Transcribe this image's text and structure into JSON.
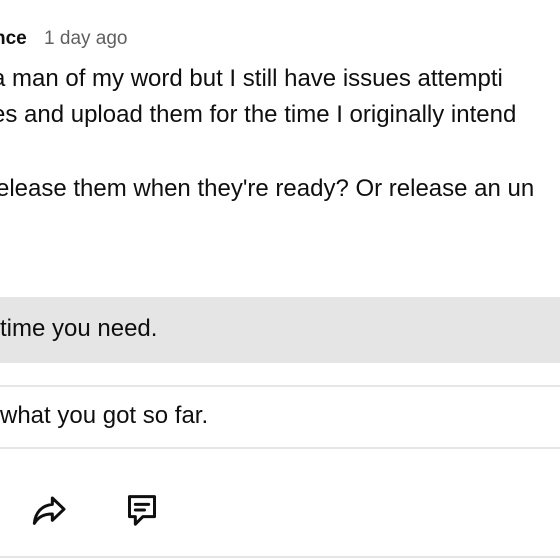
{
  "post": {
    "author": "nce",
    "timestamp": "1 day ago",
    "body_lines": [
      "a man of my word but I still have issues attempti",
      "es and upload them for the time I originally intend",
      "release them when they're ready? Or release an un"
    ]
  },
  "poll": {
    "options": [
      {
        "label": "time you need.",
        "state": "selected"
      },
      {
        "label": "what you got so far.",
        "state": "unselected"
      }
    ]
  },
  "actions": {
    "share_icon": "share-icon",
    "comment_icon": "comment-icon"
  },
  "colors": {
    "text": "#0f0f0f",
    "secondary_text": "#606060",
    "selected_option_bg": "#e5e5e5",
    "divider": "#e6e6e6"
  }
}
